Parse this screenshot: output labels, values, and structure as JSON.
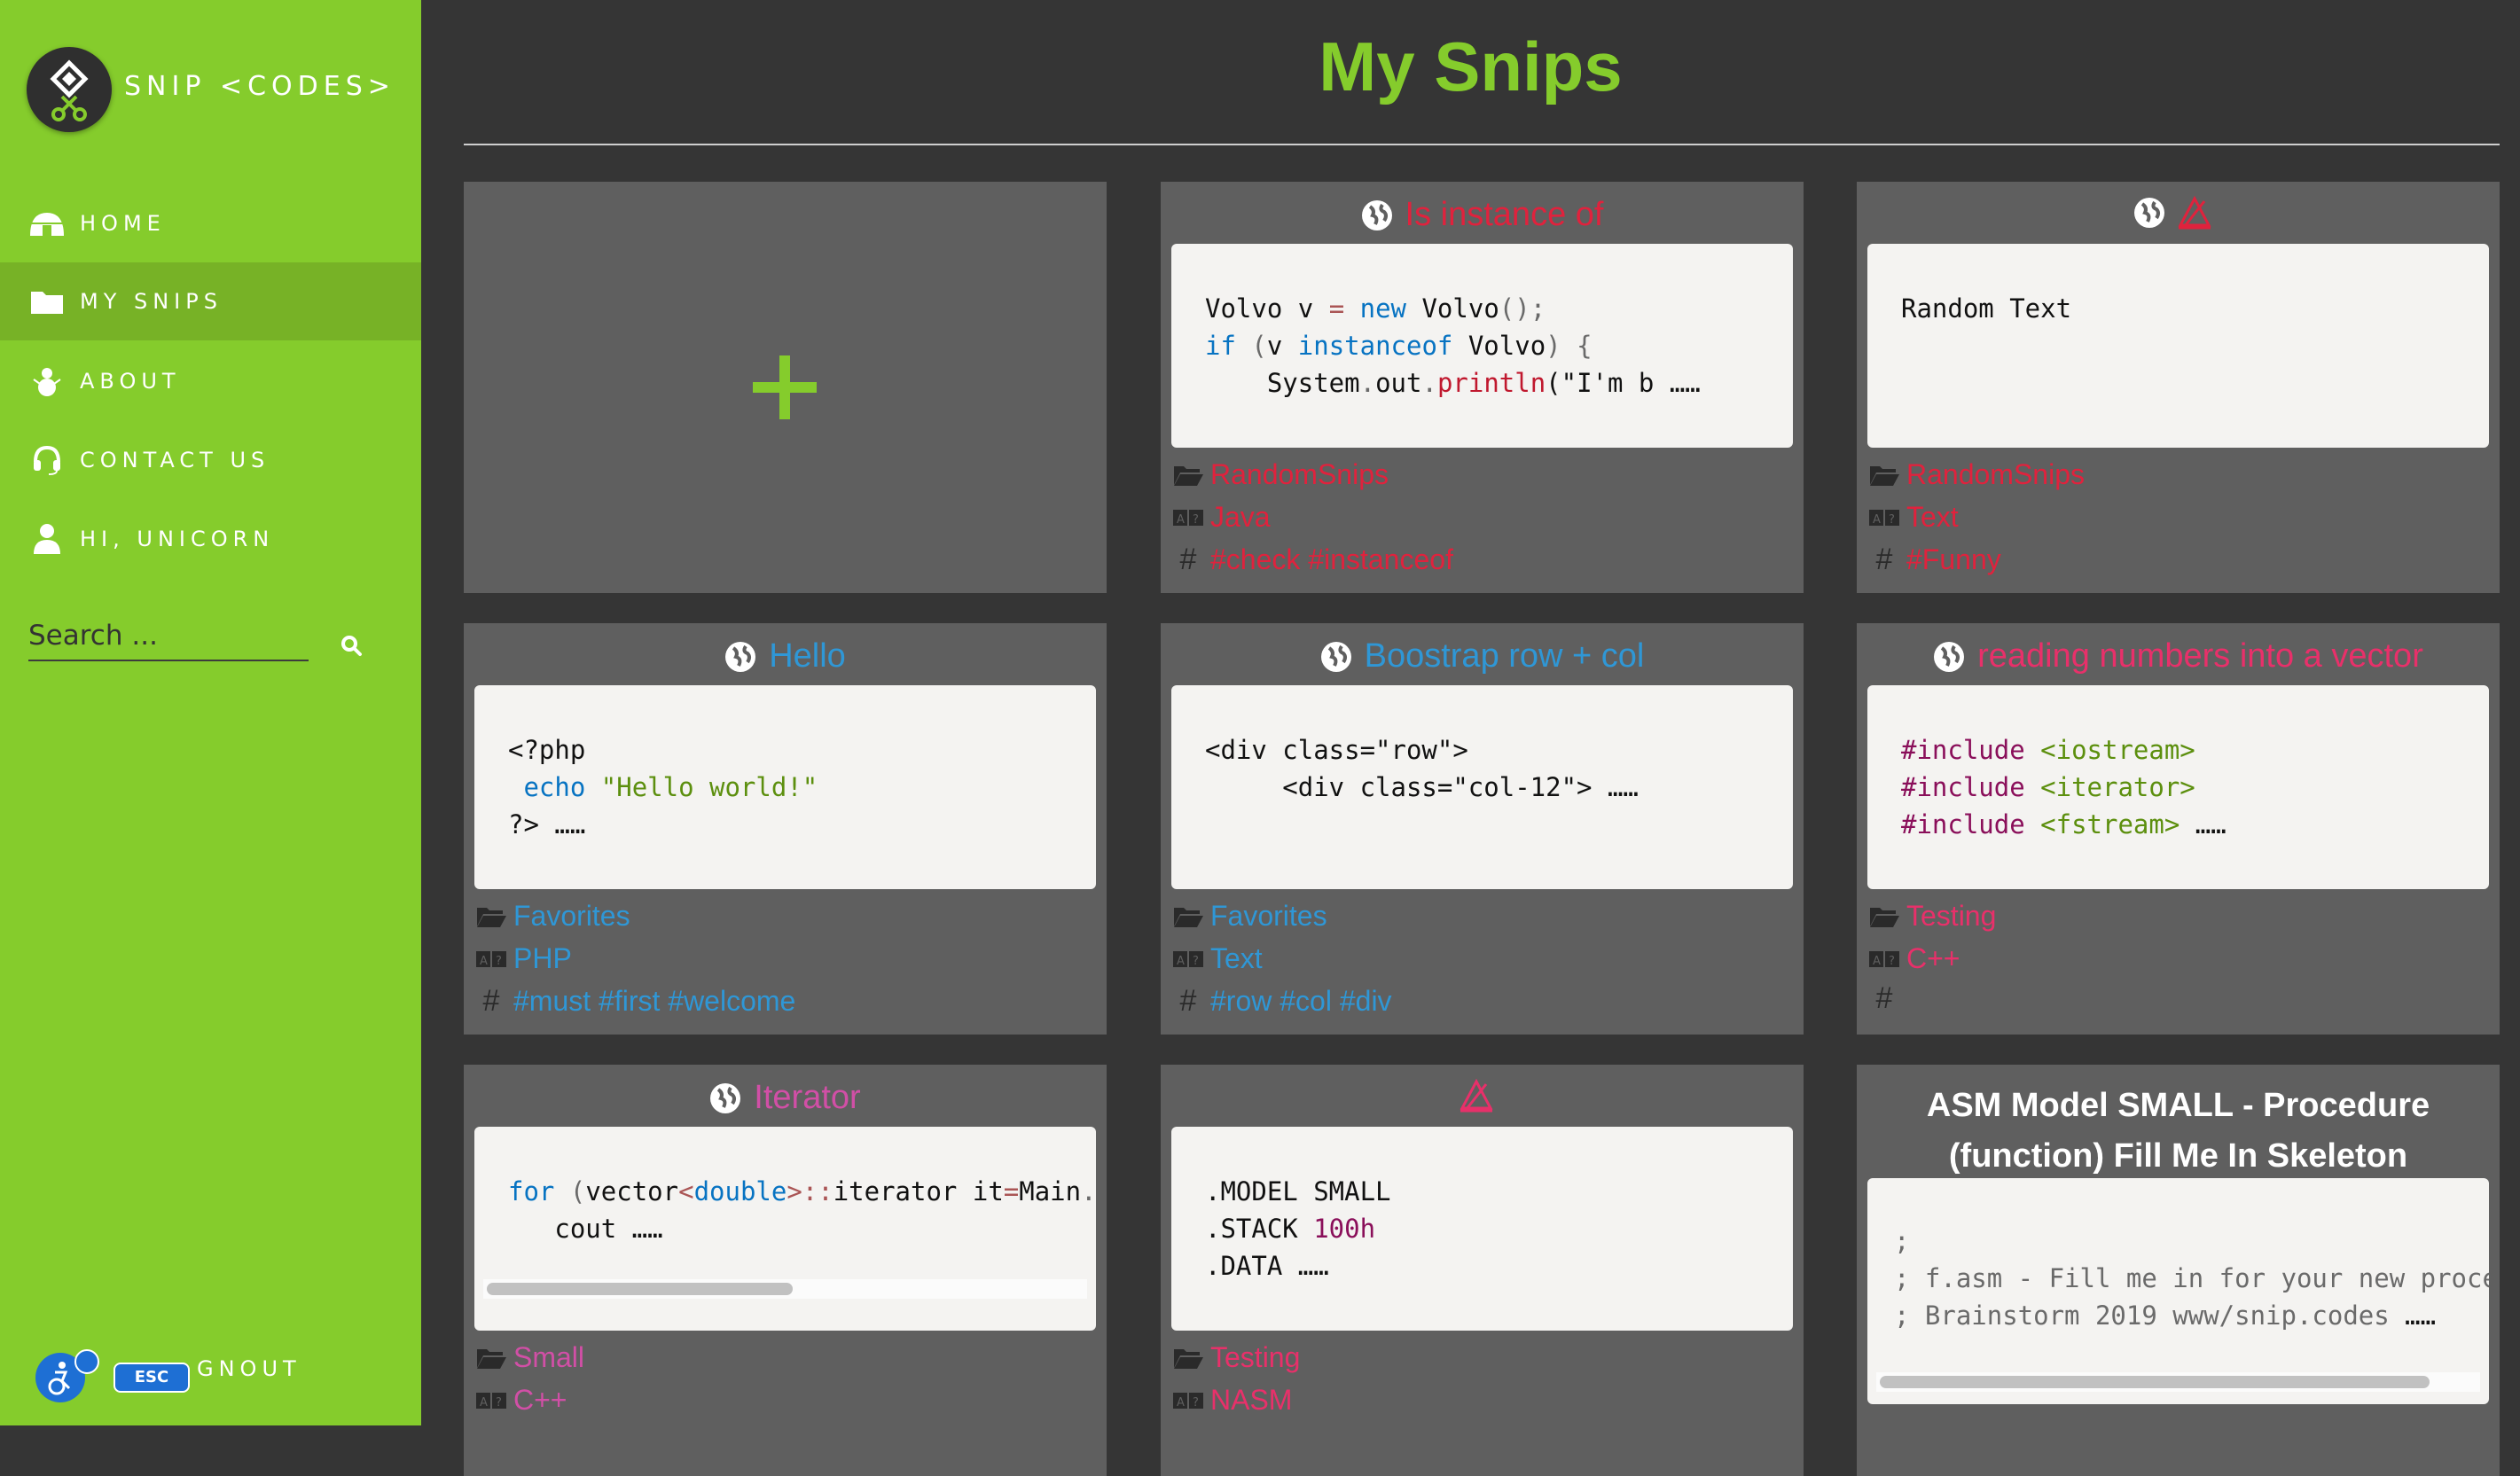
{
  "app": {
    "logo_text": "SNIP <CODES>"
  },
  "sidebar": {
    "items": [
      {
        "label": "HOME",
        "icon": "igloo-icon"
      },
      {
        "label": "MY SNIPS",
        "icon": "folder-icon",
        "active": true
      },
      {
        "label": "ABOUT",
        "icon": "snowman-icon"
      },
      {
        "label": "CONTACT US",
        "icon": "headset-icon"
      },
      {
        "label": "HI, UNICORN",
        "icon": "user-icon"
      }
    ],
    "search": {
      "placeholder": "Search ...",
      "value": ""
    },
    "logout_label": "GNOUT",
    "esc_label": "ESC"
  },
  "main": {
    "title": "My Snips",
    "add_symbol": "+"
  },
  "colors": {
    "brand_green": "#85cc2c",
    "sidebar_active": "#77b226",
    "card_bg": "#5f5f5f",
    "page_bg": "#353535",
    "red": "#e0223d",
    "blue": "#2f97d6",
    "pink": "#e8306a",
    "magenta": "#d14fa6"
  },
  "snips": [
    {
      "title": "Is instance of",
      "folder": "RandomSnips",
      "language": "Java",
      "tags": "#check #instanceof"
    },
    {
      "title": "",
      "folder": "RandomSnips",
      "language": "Text",
      "tags": "#Funny",
      "code": "Random Text"
    },
    {
      "title": "Hello",
      "folder": "Favorites",
      "language": "PHP",
      "tags": "#must #first #welcome"
    },
    {
      "title": "Boostrap row + col",
      "folder": "Favorites",
      "language": "Text",
      "tags": "#row #col #div"
    },
    {
      "title": "reading numbers into a vector",
      "folder": "Testing",
      "language": "C++",
      "tags": ""
    },
    {
      "title": "Iterator",
      "folder": "Small",
      "language": "C++",
      "tags": ""
    },
    {
      "title": "",
      "folder": "Testing",
      "language": "NASM",
      "tags": ""
    },
    {
      "title": "ASM Model SMALL - Procedure (function) Fill Me In Skeleton",
      "folder": "",
      "language": "",
      "tags": ""
    }
  ]
}
